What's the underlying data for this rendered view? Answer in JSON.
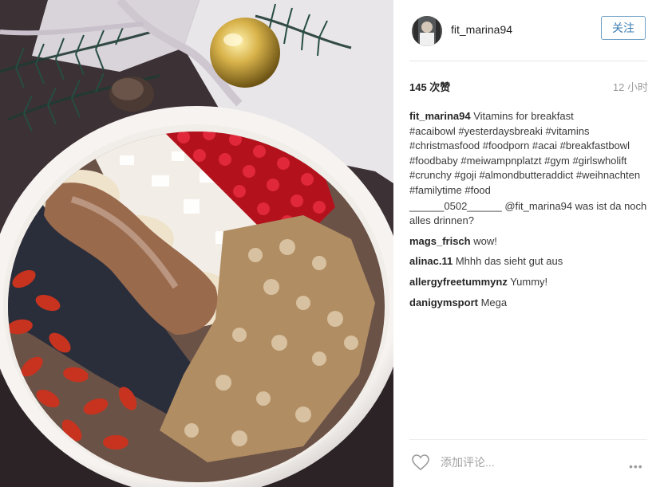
{
  "post": {
    "username": "fit_marina94",
    "follow_label": "关注",
    "likes": "145 次赞",
    "time": "12 小时",
    "add_comment_placeholder": "添加评论...",
    "more_label": "•••"
  },
  "comments": [
    {
      "user": "fit_marina94",
      "text": "Vitamins for breakfast\n#acaibowl #yesterdaysbreaki #vitamins #christmasfood #foodporn #acai #breakfastbowl #foodbaby #meiwampnplatzt #gym #girlswholift #crunchy #goji #almondbutteraddict #weihnachten #familytime #food"
    },
    {
      "user": "______0502______",
      "text": "@fit_marina94 was ist da noch alles drinnen?"
    },
    {
      "user": "mags_frisch",
      "text": "wow!"
    },
    {
      "user": "alinac.11",
      "text": "Mhhh das sieht gut aus"
    },
    {
      "user": "allergyfreetummynz",
      "text": "Yummy!"
    },
    {
      "user": "danigymsport",
      "text": "Mega"
    }
  ],
  "icons": {
    "heart": "heart-icon",
    "more": "ellipsis-icon",
    "avatar": "avatar"
  },
  "colors": {
    "follow_border": "#6d9ec4",
    "follow_text": "#3a7cb2",
    "muted": "#9b9b9b"
  }
}
